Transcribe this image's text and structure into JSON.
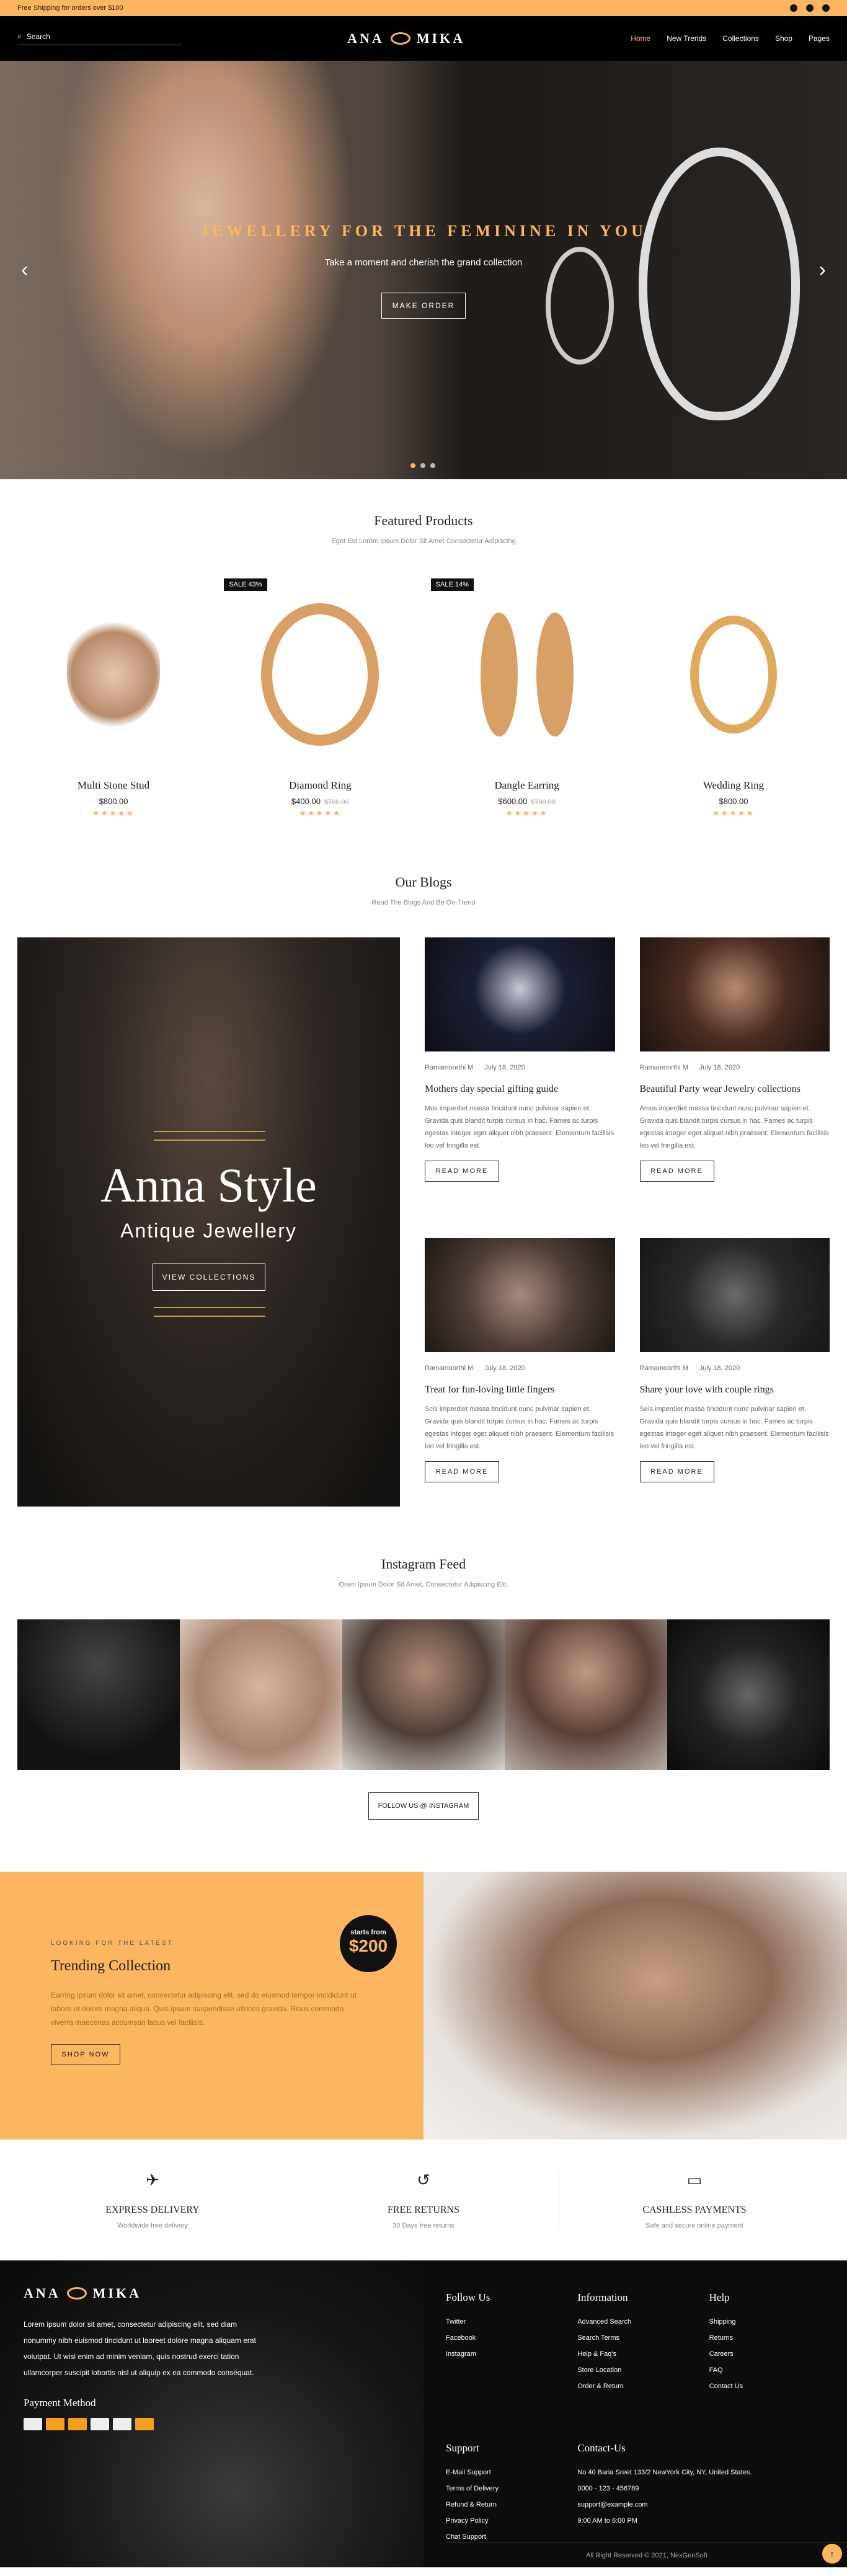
{
  "topbar": {
    "text": "Free Shipping for orders over $100"
  },
  "header": {
    "search_placeholder": "Search",
    "logo": "ANA MIKA",
    "nav": [
      "Home",
      "New Trends",
      "Collections",
      "Shop",
      "Pages"
    ]
  },
  "hero": {
    "title": "JEWELLERY FOR THE FEMININE IN YOU",
    "subtitle": "Take a moment and cherish the grand collection",
    "button": "MAKE ORDER"
  },
  "featured": {
    "title": "Featured Products",
    "subtitle": "Eget Est Lorem Ipsum Dolor Sit Amet Consectetur Adipiscing",
    "products": [
      {
        "name": "Multi Stone Stud",
        "price": "$800.00",
        "old": "",
        "sale": ""
      },
      {
        "name": "Diamond Ring",
        "price": "$400.00",
        "old": "$700.00",
        "sale": "SALE 43%"
      },
      {
        "name": "Dangle Earring",
        "price": "$600.00",
        "old": "$700.00",
        "sale": "SALE 14%"
      },
      {
        "name": "Wedding Ring",
        "price": "$800.00",
        "old": "",
        "sale": ""
      }
    ],
    "stars": "★★★★★"
  },
  "blogs": {
    "title": "Our Blogs",
    "subtitle": "Read The Blogs And Be On-Trend",
    "promo_title": "Anna Style",
    "promo_sub": "Antique Jewellery",
    "promo_btn": "VIEW COLLECTIONS",
    "posts": [
      {
        "author": "Ramamoorthi M",
        "date": "July 18, 2020",
        "title": "Mothers day special gifting guide",
        "excerpt": "Mos imperdiet massa tincidunt nunc pulvinar sapien et. Gravida quis blandit turpis cursus in hac. Fames ac turpis egestas integer eget aliquet nibh praesent. Elementum facilisis leo vel fringilla est.",
        "btn": "READ MORE"
      },
      {
        "author": "Ramamoorthi M",
        "date": "July 18, 2020",
        "title": "Beautiful Party wear Jewelry collections",
        "excerpt": "Amos imperdiet massa tincidunt nunc pulvinar sapien et. Gravida quis blandit turpis cursus in hac. Fames ac turpis egestas integer eget aliquet nibh praesent. Elementum facilisis leo vel fringilla est.",
        "btn": "READ MORE"
      },
      {
        "author": "Ramamoorthi M",
        "date": "July 18, 2020",
        "title": "Treat for fun-loving little fingers",
        "excerpt": "Scis imperdiet massa tincidunt nunc pulvinar sapien et. Gravida quis blandit turpis cursus in hac. Fames ac turpis egestas integer eget aliquet nibh praesent. Elementum facilisis leo vel fringilla est.",
        "btn": "READ MORE"
      },
      {
        "author": "Ramamoorthi M",
        "date": "July 18, 2020",
        "title": "Share your love with couple rings",
        "excerpt": "Seis imperdiet massa tincidunt nunc pulvinar sapien et. Gravida quis blandit turpis cursus in hac. Fames ac turpis egestas integer eget aliquet nibh praesent. Elementum facilisis leo vel fringilla est.",
        "btn": "READ MORE"
      }
    ]
  },
  "instagram": {
    "title": "Instagram Feed",
    "subtitle": "Orem Ipsum Dolor Sit Amet, Consectetur Adipiscing Elit.",
    "button": "FOLLOW US @ INSTAGRAM"
  },
  "promo": {
    "kicker": "LOOKING FOR THE LATEST",
    "title": "Trending Collection",
    "text": "Earring ipsum dolor sit amet, consectetur adipiscing elit, sed do eiusmod tempor incididunt ut labore et dolore magna aliqua. Quis ipsum suspendisse ultrices gravida. Risus commodo viverra maecenas accumsan lacus vel facilisis.",
    "button": "SHOP NOW",
    "badge_top": "starts from",
    "badge_price": "$200"
  },
  "features": [
    {
      "title": "EXPRESS DELIVERY",
      "sub": "Worldwide free delivery"
    },
    {
      "title": "FREE RETURNS",
      "sub": "30 Days free returns"
    },
    {
      "title": "CASHLESS PAYMENTS",
      "sub": "Safe and secure online payment"
    }
  ],
  "footer": {
    "about": "Lorem ipsum dolor sit amet, consectetur adipiscing elit, sed diam nonummy nibh euismod tincidunt ut laoreet dolore magna aliquam erat volutpat. Ut wisi enim ad minim veniam, quis nostrud exerci tation ullamcorper suscipit lobortis nisl ut aliquip ex ea commodo consequat.",
    "payment": "Payment Method",
    "follow_title": "Follow Us",
    "follow": [
      "Twitter",
      "Facebook",
      "Instagram"
    ],
    "info_title": "Information",
    "info": [
      "Advanced Search",
      "Search Terms",
      "Help & Faq's",
      "Store Location",
      "Order & Return"
    ],
    "help_title": "Help",
    "help": [
      "Shipping",
      "Returns",
      "Careers",
      "FAQ",
      "Contact Us"
    ],
    "support_title": "Support",
    "support": [
      "E-Mail Support",
      "Terms of Delivery",
      "Refund & Return",
      "Privacy Policy",
      "Chat Support"
    ],
    "contact_title": "Contact-Us",
    "contact": [
      "No 40 Baria Sreet 133/2 NewYork City, NY, United States.",
      "0000 - 123 - 456789",
      "support@example.com",
      "9:00 AM to 6:00 PM"
    ],
    "copyright": "All Right Reserved © 2021, NexGenSoft"
  }
}
